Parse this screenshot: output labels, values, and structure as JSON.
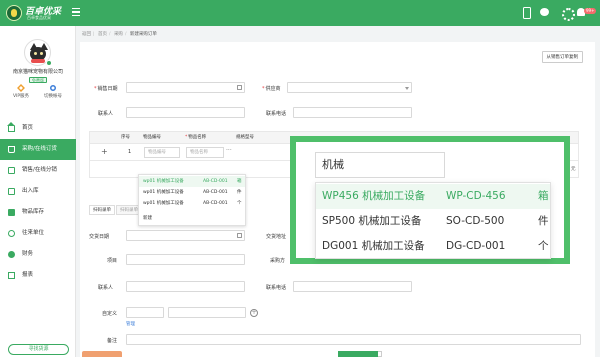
{
  "brand": {
    "title": "百卓优采",
    "subtitle": "百卓食品优采"
  },
  "topbar": {
    "bell_count": "99+"
  },
  "sidebar": {
    "company": "南京猫咪宠物有限公司",
    "vip_badge": "免费版",
    "vip_service": "VIP服务",
    "switch_account": "切换帐号",
    "items": [
      {
        "label": "首页",
        "icon": "home-icon"
      },
      {
        "label": "采购/在线订货",
        "icon": "cart-icon",
        "active": true
      },
      {
        "label": "销售/在线分销",
        "icon": "sale-icon"
      },
      {
        "label": "出入库",
        "icon": "inout-icon"
      },
      {
        "label": "物品库存",
        "icon": "stock-icon"
      },
      {
        "label": "往来单位",
        "icon": "partner-icon"
      },
      {
        "label": "财务",
        "icon": "finance-icon"
      },
      {
        "label": "报表",
        "icon": "report-icon"
      }
    ],
    "service_button": "寻找货源"
  },
  "breadcrumb": {
    "items": [
      "返回",
      "首页",
      "采购",
      "新建采购订单"
    ]
  },
  "form": {
    "copy_button": "从销售订单复制",
    "sales_date_label": "销售日期",
    "supplier_label": "供应商",
    "contact_label": "联系人",
    "phone_label": "联系电话"
  },
  "table": {
    "headers": [
      "序号",
      "物品编号",
      "物品名称",
      "规格型号"
    ],
    "row_number": "1",
    "code_placeholder": "物品编号",
    "name_placeholder": "物品名称",
    "ellipsis": "···",
    "summary_tail": "元"
  },
  "mini_dropdown": {
    "items": [
      {
        "code": "wp01 机械加工设备",
        "spec": "AB-CD-001",
        "unit": "箱"
      },
      {
        "code": "wp01 机械加工设备",
        "spec": "AB-CD-001",
        "unit": "件"
      },
      {
        "code": "wp01 机械加工设备",
        "spec": "AB-CD-001",
        "unit": "个"
      }
    ],
    "new_label": "新建"
  },
  "lower": {
    "tab_scan": "扫码录单",
    "tab_other": "扫码录单",
    "delivery_date_label": "交货日期",
    "delivery_addr_label": "交货地址",
    "project_label": "项目",
    "purchaser_label": "采购方",
    "contact_label": "联系人",
    "phone_label": "联系电话",
    "custom_label": "自定义",
    "manage_link": "管理",
    "remark_label": "备注"
  },
  "popup": {
    "search_value": "机械",
    "items": [
      {
        "name": "WP456 机械加工设备",
        "spec": "WP-CD-456",
        "unit": "箱",
        "highlighted": true
      },
      {
        "name": "SP500 机械加工设备",
        "spec": "SO-CD-500",
        "unit": "件",
        "highlighted": false
      },
      {
        "name": "DG001 机械加工设备",
        "spec": "DG-CD-001",
        "unit": "个",
        "highlighted": false
      }
    ]
  },
  "colors": {
    "brand_green": "#3aaa61",
    "popup_border": "#4fbf6a",
    "required": "#e4393c",
    "badge_red": "#f56c6c"
  }
}
